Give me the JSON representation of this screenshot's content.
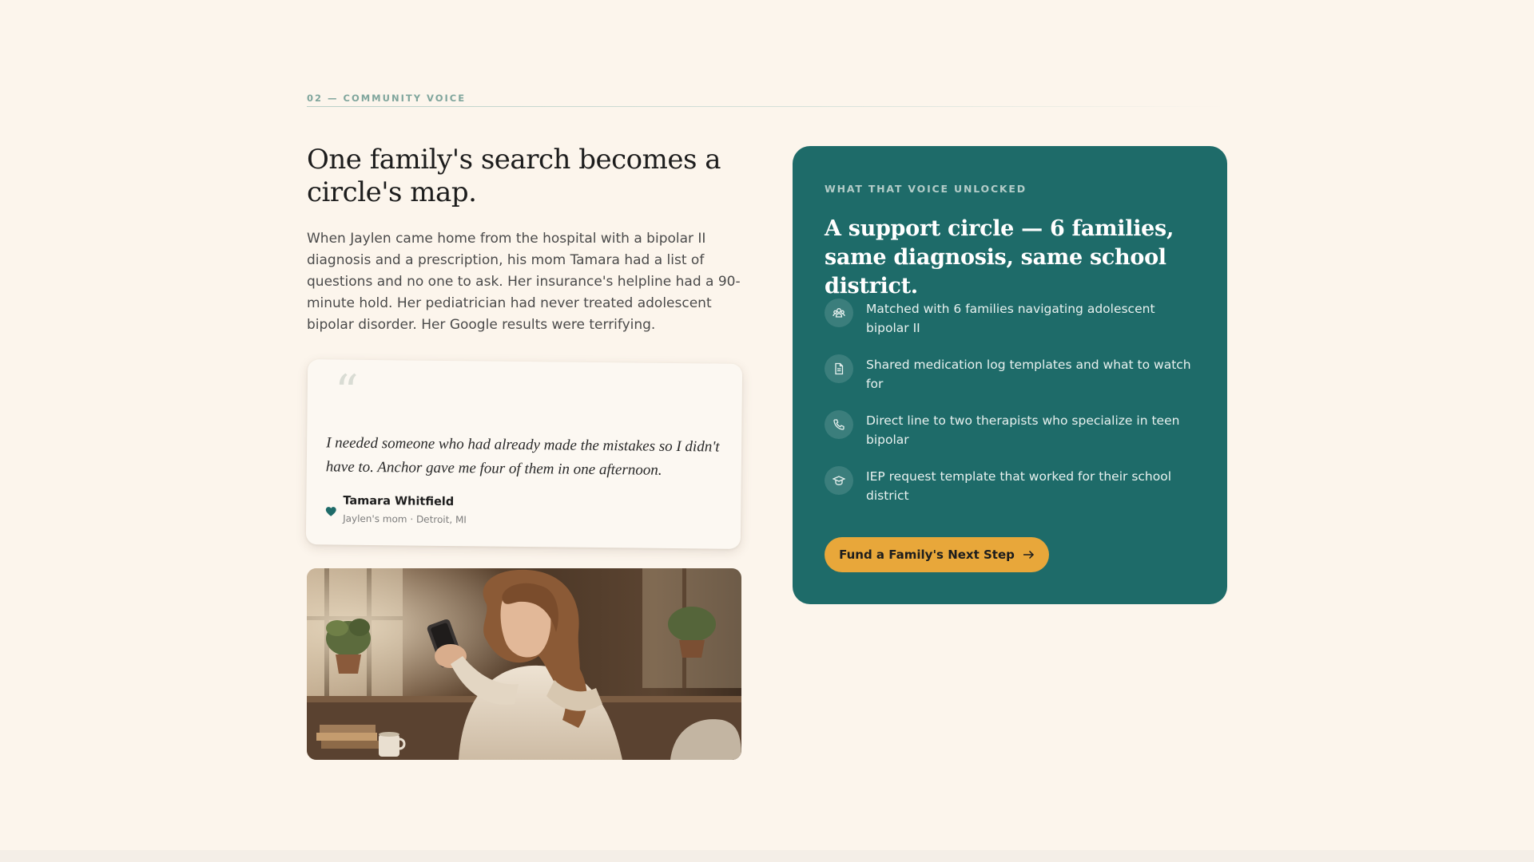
{
  "section": {
    "label": "02 — COMMUNITY VOICE"
  },
  "story": {
    "headline": "One family's search becomes a circle's map.",
    "body": "When Jaylen came home from the hospital with a bipolar II diagnosis and a prescription, his mom Tamara had a list of questions and no one to ask. Her insurance's helpline had a 90-minute hold. Her pediatrician had never treated adolescent bipolar disorder. Her Google results were terrifying."
  },
  "quote": {
    "mark": "“",
    "text": "I needed someone who had already made the mistakes so I didn't have to. Anchor gave me four of them in one afternoon.",
    "name": "Tamara Whitfield",
    "role": "Jaylen's mom · Detroit, MI",
    "icon": "heart-icon"
  },
  "photo": {
    "subject": "woman-using-phone-photo"
  },
  "panel": {
    "label": "WHAT THAT VOICE UNLOCKED",
    "title": "A support circle — 6 families, same diagnosis, same school district.",
    "benefits": [
      {
        "icon": "people-icon",
        "text": "Matched with 6 families navigating adolescent bipolar II"
      },
      {
        "icon": "document-icon",
        "text": "Shared medication log templates and what to watch for"
      },
      {
        "icon": "phone-icon",
        "text": "Direct line to two therapists who specialize in teen bipolar"
      },
      {
        "icon": "graduation-cap-icon",
        "text": "IEP request template that worked for their school district"
      }
    ],
    "cta_label": "Fund a Family's Next Step",
    "cta_icon": "arrow-right-icon"
  },
  "colors": {
    "background": "#fcf5ec",
    "panel": "#1e6b69",
    "accent": "#e8a73a",
    "label": "#7fa59c"
  }
}
